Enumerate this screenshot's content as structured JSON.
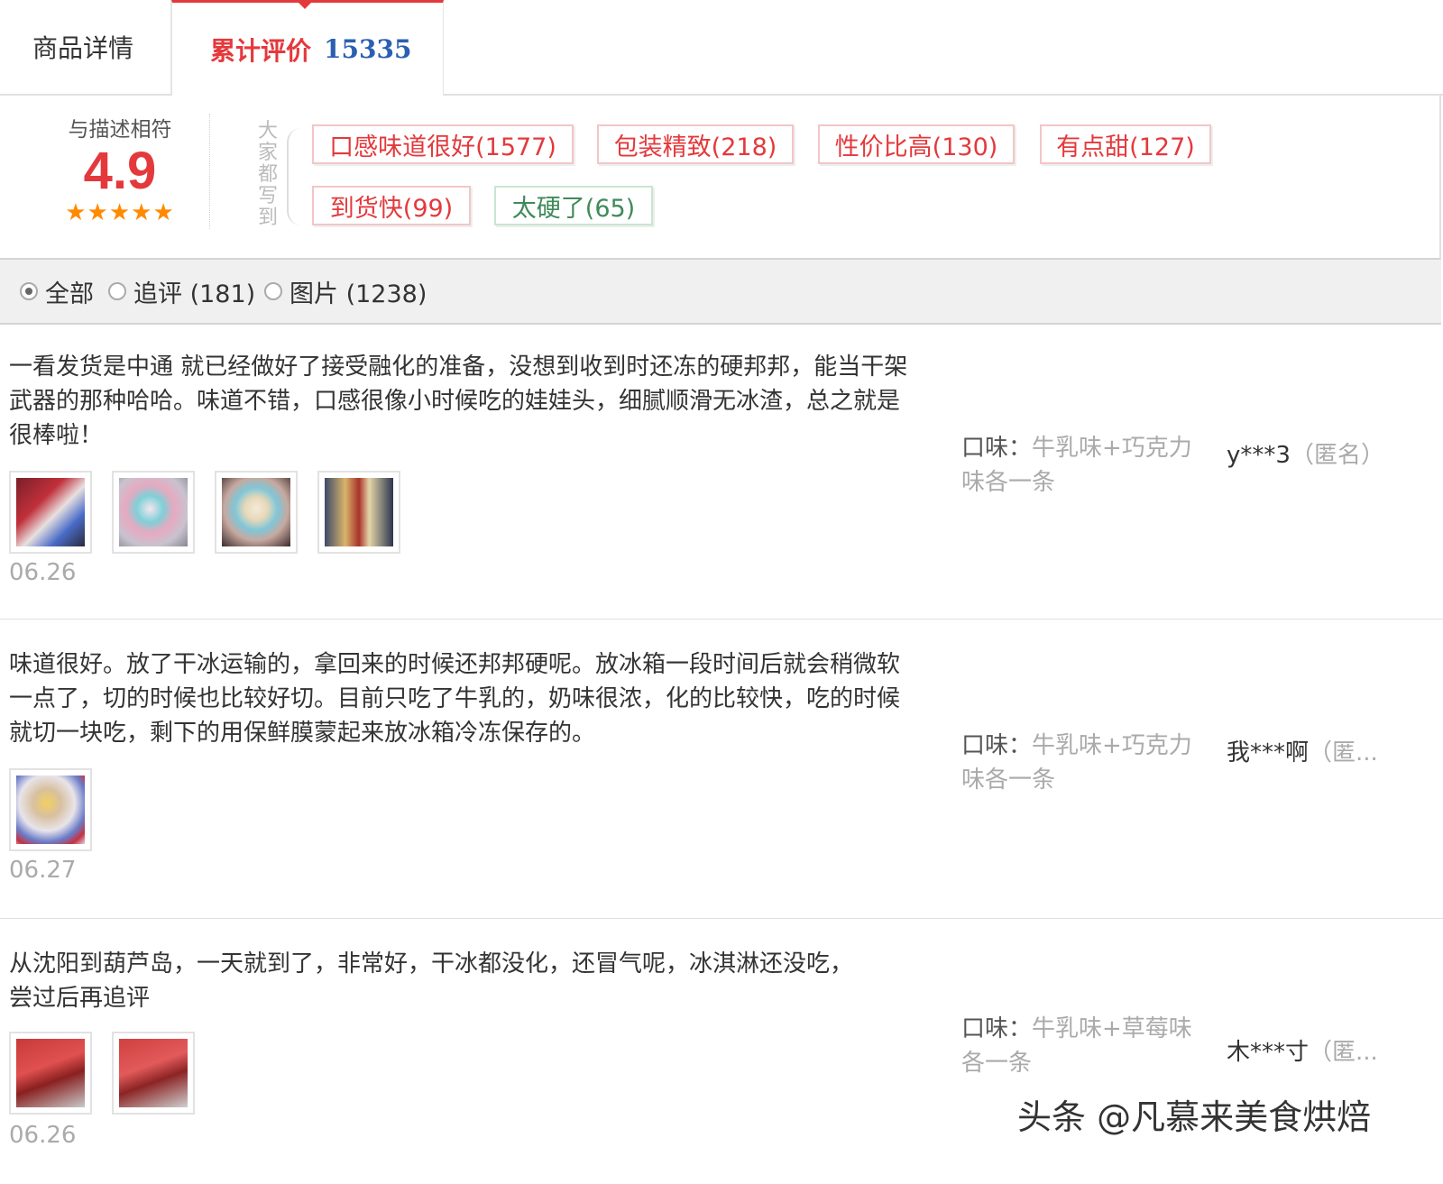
{
  "tabs": {
    "details": "商品详情",
    "reviews_label": "累计评价",
    "reviews_count": "15335"
  },
  "summary": {
    "title": "与描述相符",
    "score": "4.9",
    "stars": "★★★★★",
    "side_label": "大家都写到",
    "tags": [
      {
        "label": "口感味道很好(1577)",
        "type": "positive"
      },
      {
        "label": "包装精致(218)",
        "type": "positive"
      },
      {
        "label": "性价比高(130)",
        "type": "positive"
      },
      {
        "label": "有点甜(127)",
        "type": "positive"
      },
      {
        "label": "到货快(99)",
        "type": "positive"
      },
      {
        "label": "太硬了(65)",
        "type": "negative"
      }
    ]
  },
  "filter": {
    "all": "全部",
    "followup": "追评 (181)",
    "pictures": "图片 (1238)",
    "selected": "all"
  },
  "reviews": [
    {
      "text": "一看发货是中通 就已经做好了接受融化的准备，没想到收到时还冻的硬邦邦，能当干架武器的那种哈哈。味道不错，口感很像小时候吃的娃娃头，细腻顺滑无冰渣，总之就是很棒啦！",
      "date": "06.26",
      "flavor_key": "口味：",
      "flavor_value": "牛乳味+巧克力味各一条",
      "user": "y***3",
      "anon": "（匿名）"
    },
    {
      "text": "味道很好。放了干冰运输的，拿回来的时候还邦邦硬呢。放冰箱一段时间后就会稍微软一点了，切的时候也比较好切。目前只吃了牛乳的，奶味很浓，化的比较快，吃的时候就切一块吃，剩下的用保鲜膜蒙起来放冰箱冷冻保存的。",
      "date": "06.27",
      "flavor_key": "口味：",
      "flavor_value": "牛乳味+巧克力味各一条",
      "user": "我***啊",
      "anon": "（匿..."
    },
    {
      "text": "从沈阳到葫芦岛，一天就到了，非常好，干冰都没化，还冒气呢，冰淇淋还没吃，尝过后再追评",
      "date": "06.26",
      "flavor_key": "口味：",
      "flavor_value": "牛乳味+草莓味各一条",
      "user": "木***寸",
      "anon": "（匿..."
    }
  ],
  "watermark": "头条 @凡慕来美食烘焙",
  "colors": {
    "accent_red": "#e4393c",
    "count_blue": "#2b5fb3",
    "star_orange": "#ff8a00",
    "negative_tag_green": "#3f8a5a"
  }
}
